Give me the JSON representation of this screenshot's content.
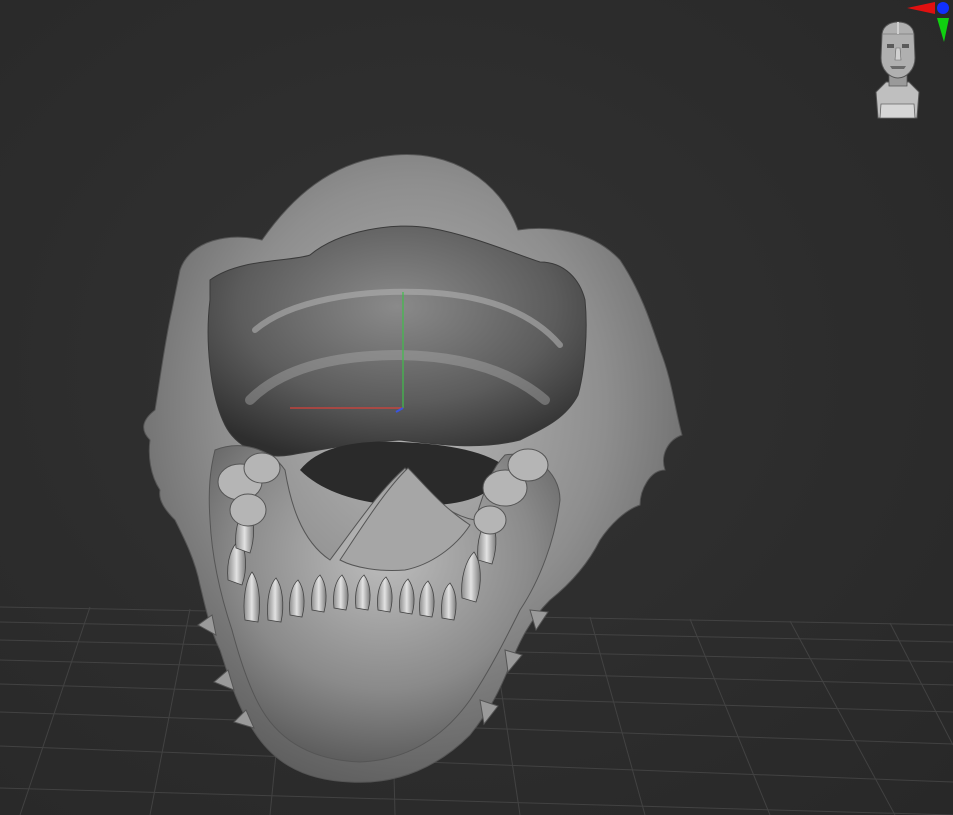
{
  "viewport": {
    "background": "#2d2d2d",
    "grid_color": "#4a4a4a",
    "model_color": "#9a9a9a",
    "model_highlight": "#c8c8c8",
    "model_shadow": "#3a3a3a"
  },
  "transpose_axes": {
    "x_color": "#d8413a",
    "y_color": "#3fbf4a",
    "z_color": "#3a55e0"
  },
  "navigation_gizmo": {
    "icon": "head-orientation-icon",
    "x_color": "#e01010",
    "y_color": "#10d010",
    "z_color": "#1030ff"
  }
}
